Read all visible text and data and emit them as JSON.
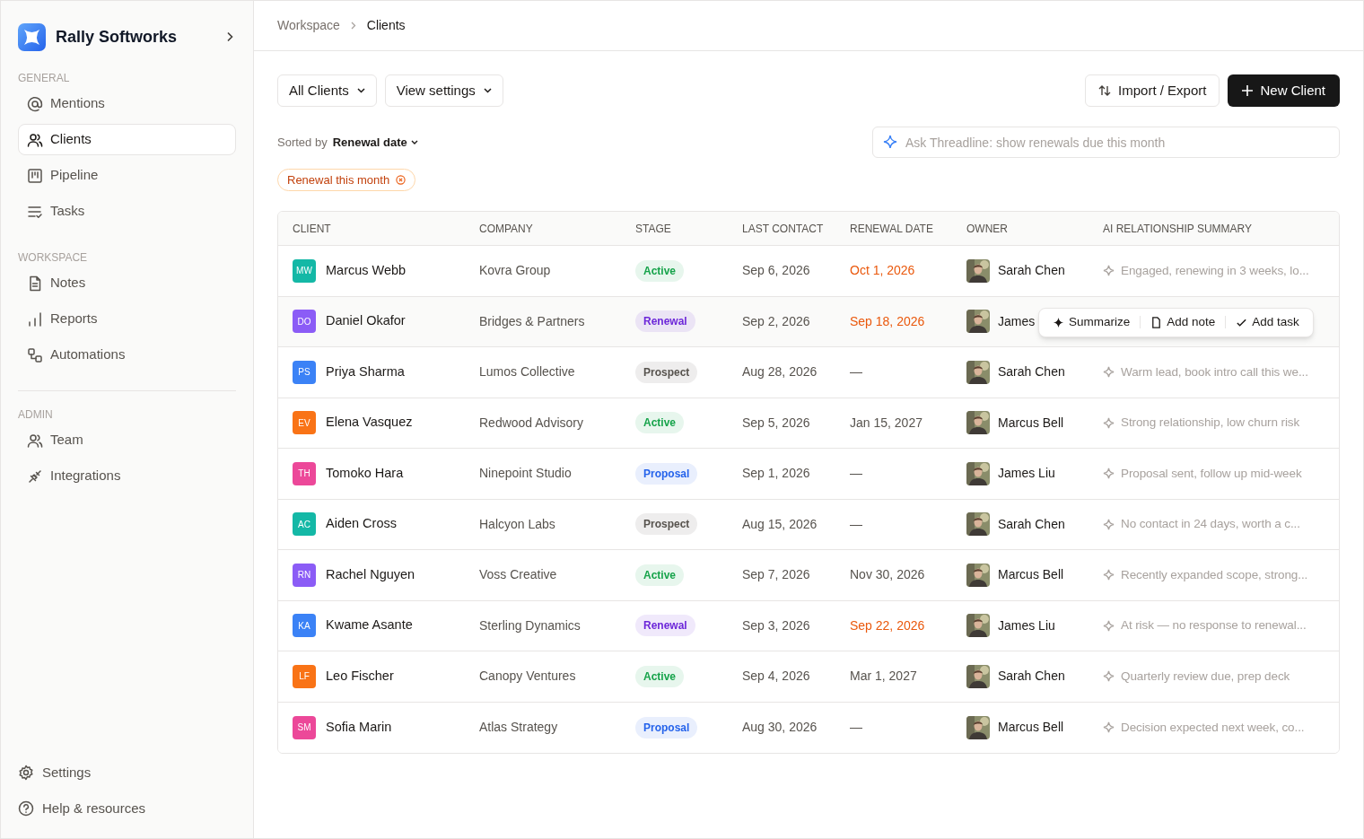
{
  "brand": {
    "name": "Rally Softworks"
  },
  "sidebar": {
    "sections": [
      {
        "title": "GENERAL",
        "items": [
          {
            "label": "Mentions",
            "selected": false
          },
          {
            "label": "Clients",
            "selected": true
          },
          {
            "label": "Pipeline",
            "selected": false
          },
          {
            "label": "Tasks",
            "selected": false
          }
        ]
      },
      {
        "title": "WORKSPACE",
        "items": [
          {
            "label": "Notes",
            "selected": false
          },
          {
            "label": "Reports",
            "selected": false
          },
          {
            "label": "Automations",
            "selected": false
          }
        ]
      },
      {
        "title": "ADMIN",
        "items": [
          {
            "label": "Team",
            "selected": false
          },
          {
            "label": "Integrations",
            "selected": false
          }
        ]
      }
    ],
    "footer": [
      "Settings",
      "Help & resources"
    ]
  },
  "breadcrumb": [
    "Workspace",
    "Clients"
  ],
  "toolbar": {
    "filters": [
      "All Clients",
      "View settings"
    ],
    "import_export": "Import / Export",
    "new_client": "New Client"
  },
  "sort": {
    "label": "Sorted by",
    "value": "Renewal date"
  },
  "ask": {
    "placeholder": "Ask Threadline: show renewals due this month"
  },
  "active_filter": "Renewal this month",
  "table": {
    "columns": [
      "CLIENT",
      "COMPANY",
      "STAGE",
      "LAST CONTACT",
      "RENEWAL DATE",
      "OWNER",
      "AI RELATIONSHIP SUMMARY"
    ],
    "rows": [
      {
        "initials": "MW",
        "color": "#14b8a6",
        "client": "Marcus Webb",
        "company": "Kovra Group",
        "stage": {
          "label": "Active",
          "color": "#16a34a"
        },
        "last_contact": "Sep 6, 2026",
        "renewal": "Oct 1, 2026",
        "urgent": true,
        "owner": "Sarah Chen",
        "summary": "Engaged, renewing in 3 weeks, lo..."
      },
      {
        "initials": "DO",
        "color": "#8b5cf6",
        "client": "Daniel Okafor",
        "company": "Bridges & Partners",
        "stage": {
          "label": "Renewal",
          "color": "#6d28d9"
        },
        "last_contact": "Sep 2, 2026",
        "renewal": "Sep 18, 2026",
        "urgent": true,
        "owner": "James",
        "actions": [
          "Summarize",
          "Add note",
          "Add task"
        ]
      },
      {
        "initials": "PS",
        "color": "#3b82f6",
        "client": "Priya Sharma",
        "company": "Lumos Collective",
        "stage": {
          "label": "Prospect",
          "color": "#57534e"
        },
        "last_contact": "Aug 28, 2026",
        "renewal": "—",
        "urgent": false,
        "owner": "Sarah Chen",
        "summary": "Warm lead, book intro call this we..."
      },
      {
        "initials": "EV",
        "color": "#f97316",
        "client": "Elena Vasquez",
        "company": "Redwood Advisory",
        "stage": {
          "label": "Active",
          "color": "#16a34a"
        },
        "last_contact": "Sep 5, 2026",
        "renewal": "Jan 15, 2027",
        "urgent": false,
        "owner": "Marcus Bell",
        "summary": "Strong relationship, low churn risk"
      },
      {
        "initials": "TH",
        "color": "#ec4899",
        "client": "Tomoko Hara",
        "company": "Ninepoint Studio",
        "stage": {
          "label": "Proposal",
          "color": "#2563eb"
        },
        "last_contact": "Sep 1, 2026",
        "renewal": "—",
        "urgent": false,
        "owner": "James Liu",
        "summary": "Proposal sent, follow up mid-week"
      },
      {
        "initials": "AC",
        "color": "#14b8a6",
        "client": "Aiden Cross",
        "company": "Halcyon Labs",
        "stage": {
          "label": "Prospect",
          "color": "#57534e"
        },
        "last_contact": "Aug 15, 2026",
        "renewal": "—",
        "urgent": false,
        "owner": "Sarah Chen",
        "summary": "No contact in 24 days, worth a c..."
      },
      {
        "initials": "RN",
        "color": "#8b5cf6",
        "client": "Rachel Nguyen",
        "company": "Voss Creative",
        "stage": {
          "label": "Active",
          "color": "#16a34a"
        },
        "last_contact": "Sep 7, 2026",
        "renewal": "Nov 30, 2026",
        "urgent": false,
        "owner": "Marcus Bell",
        "summary": "Recently expanded scope, strong..."
      },
      {
        "initials": "KA",
        "color": "#3b82f6",
        "client": "Kwame Asante",
        "company": "Sterling Dynamics",
        "stage": {
          "label": "Renewal",
          "color": "#6d28d9"
        },
        "last_contact": "Sep 3, 2026",
        "renewal": "Sep 22, 2026",
        "urgent": true,
        "owner": "James Liu",
        "summary": "At risk — no response to renewal..."
      },
      {
        "initials": "LF",
        "color": "#f97316",
        "client": "Leo Fischer",
        "company": "Canopy Ventures",
        "stage": {
          "label": "Active",
          "color": "#16a34a"
        },
        "last_contact": "Sep 4, 2026",
        "renewal": "Mar 1, 2027",
        "urgent": false,
        "owner": "Sarah Chen",
        "summary": "Quarterly review due, prep deck"
      },
      {
        "initials": "SM",
        "color": "#ec4899",
        "client": "Sofia Marin",
        "company": "Atlas Strategy",
        "stage": {
          "label": "Proposal",
          "color": "#2563eb"
        },
        "last_contact": "Aug 30, 2026",
        "renewal": "—",
        "urgent": false,
        "owner": "Marcus Bell",
        "summary": "Decision expected next week, co..."
      }
    ]
  }
}
